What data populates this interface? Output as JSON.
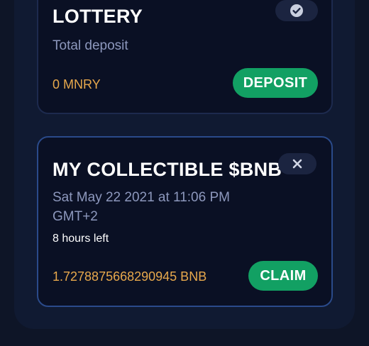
{
  "lottery_card": {
    "title": "LOTTERY",
    "subtitle": "Total deposit",
    "amount": "0 MNRY",
    "button_label": "DEPOSIT",
    "badge_icon": "check-circle-icon"
  },
  "collectible_card": {
    "title": "MY COLLECTIBLE $BNB",
    "date_line": "Sat May 22 2021 at 11:06 PM",
    "timezone": "GMT+2",
    "time_left": "8 hours left",
    "amount": "1.7278875668290945 BNB",
    "button_label": "CLAIM",
    "close_icon": "close-icon"
  },
  "colors": {
    "background": "#0e1527",
    "card": "#0a1024",
    "accent_green": "#12a063",
    "amount_orange": "#e7a84c",
    "active_border": "#2a4a8a"
  }
}
